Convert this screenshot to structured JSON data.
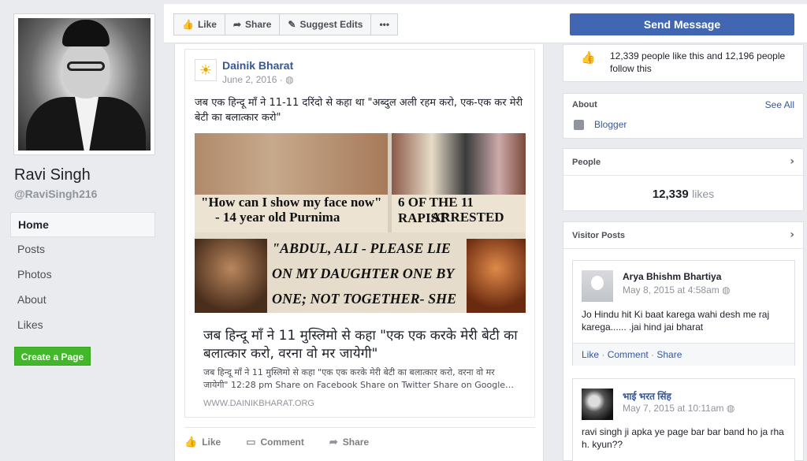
{
  "sidebar": {
    "page_name": "Ravi Singh",
    "handle": "@RaviSingh216",
    "nav": [
      "Home",
      "Posts",
      "Photos",
      "About",
      "Likes"
    ],
    "create_page": "Create a Page"
  },
  "toolbar": {
    "like": "Like",
    "share": "Share",
    "suggest_edits": "Suggest Edits",
    "more": "•••",
    "send_message": "Send Message"
  },
  "post": {
    "source_name": "Dainik Bharat",
    "date": "June 2, 2016 ·",
    "text": "जब एक हिन्दू माँ ने 11-11 दरिंदो से कहा था \"अब्दुल अली रहम करो, एक-एक कर मेरी बेटी का बलात्कार करो\"",
    "image_headlines": {
      "h1": "\"How can I show my face now\"",
      "h2": "- 14 year old Purnima",
      "h3": "6 OF THE 11 RAPIST",
      "h4": "ARRESTED",
      "h5": "\"ABDUL, ALI - PLEASE LIE",
      "h6": "ON MY DAUGHTER ONE BY",
      "h7": "ONE; NOT TOGETHER- SHE"
    },
    "link_title": "जब हिन्दू माँ ने 11 मुस्लिमो से कहा \"एक एक करके मेरी बेटी का बलात्कार करो, वरना वो मर जायेगी\"",
    "link_desc": "जब हिन्दू माँ ने 11 मुस्लिमो से कहा \"एक एक करके मेरी बेटी का बलात्कार करो, वरना वो मर जायेगी\" 12:28 pm Share on Facebook Share on Twitter Share on Google…",
    "link_url": "WWW.DAINIKBHARAT.ORG",
    "actions": [
      "Like",
      "Comment",
      "Share"
    ]
  },
  "right": {
    "likes_text": "12,339 people like this and 12,196 people follow this",
    "about_title": "About",
    "see_all": "See All",
    "about_item": "Blogger",
    "people_title": "People",
    "people_count": "12,339",
    "people_unit": "likes",
    "visitor_title": "Visitor Posts",
    "visitor_posts": [
      {
        "name": "Arya Bhishm Bhartiya",
        "date": "May 8, 2015 at 4:58am",
        "text": "Jo Hindu hit Ki baat karega wahi desh me raj karega...... .jai hind jai bharat",
        "actions": [
          "Like",
          "Comment",
          "Share"
        ]
      },
      {
        "name": "भाई भरत सिंह",
        "date": "May 7, 2015 at 10:11am",
        "text": "ravi singh ji apka ye page bar bar band ho ja rha h. kyun??"
      }
    ]
  },
  "colors": {
    "brand_blue": "#4267b2",
    "link_blue": "#365899",
    "green": "#42b72a",
    "background": "#e9ebee"
  }
}
